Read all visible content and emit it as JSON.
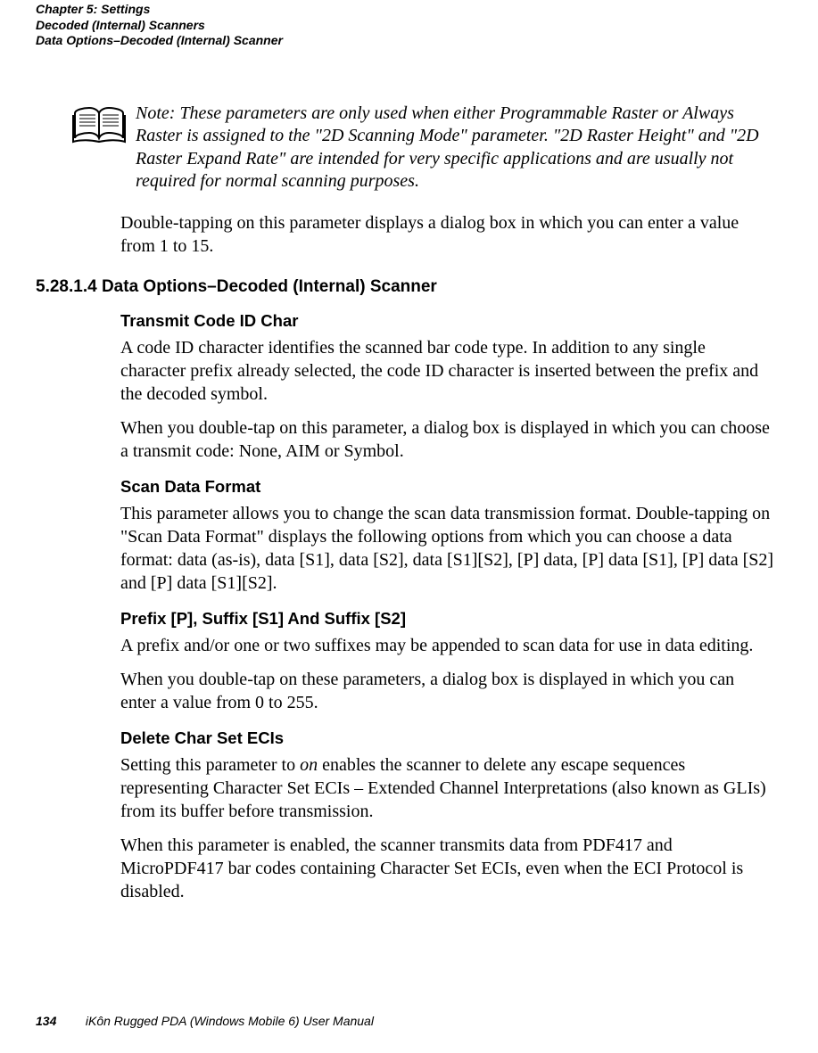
{
  "header": {
    "line1": "Chapter 5: Settings",
    "line2": "Decoded (Internal) Scanners",
    "line3": "Data Options–Decoded (Internal) Scanner"
  },
  "note": {
    "label": "Note:",
    "body": "These parameters are only used when either Programmable Raster or Always Raster is assigned to the \"2D Scanning Mode\" parameter. \"2D Raster Height\" and \"2D Raster Expand Rate\" are intended for very specific applications and are usually not required for normal scanning purposes."
  },
  "intro_para": "Double-tapping on this parameter displays a dialog box in which you can enter a value from 1 to 15.",
  "section": {
    "number": "5.28.1.4",
    "title": "Data Options–Decoded (Internal) Scanner"
  },
  "transmit": {
    "heading": "Transmit Code ID Char",
    "p1": "A code ID character identifies the scanned bar code type. In addition to any single character prefix already selected, the code ID character is inserted between the prefix and the decoded symbol.",
    "p2": "When you double-tap on this parameter, a dialog box is displayed in which you can choose a transmit code: None, AIM or Symbol."
  },
  "scanformat": {
    "heading": "Scan Data Format",
    "p1": "This parameter allows you to change the scan data transmission format. Double-tapping on \"Scan Data Format\" displays the following options from which you can choose a data format: data (as-is), data [S1], data [S2], data [S1][S2], [P] data, [P] data [S1], [P] data [S2] and [P] data [S1][S2]."
  },
  "prefix": {
    "heading": "Prefix [P], Suffix [S1] And Suffix [S2]",
    "p1": "A prefix and/or one or two suffixes may be appended to scan data for use in data editing.",
    "p2": "When you double-tap on these parameters, a dialog box is displayed in which you can enter a value from 0 to 255."
  },
  "delete": {
    "heading": "Delete Char Set ECIs",
    "p1_pre": "Setting this parameter to ",
    "p1_em": "on",
    "p1_post": " enables the scanner to delete any escape sequences representing Character Set ECIs – Extended Channel Interpretations (also known as GLIs) from its buffer before transmission.",
    "p2": "When this parameter is enabled, the scanner transmits data from PDF417 and MicroPDF417 bar codes containing Character Set ECIs, even when the ECI Protocol is disabled."
  },
  "footer": {
    "page": "134",
    "title": "iKôn Rugged PDA (Windows Mobile 6) User Manual"
  }
}
